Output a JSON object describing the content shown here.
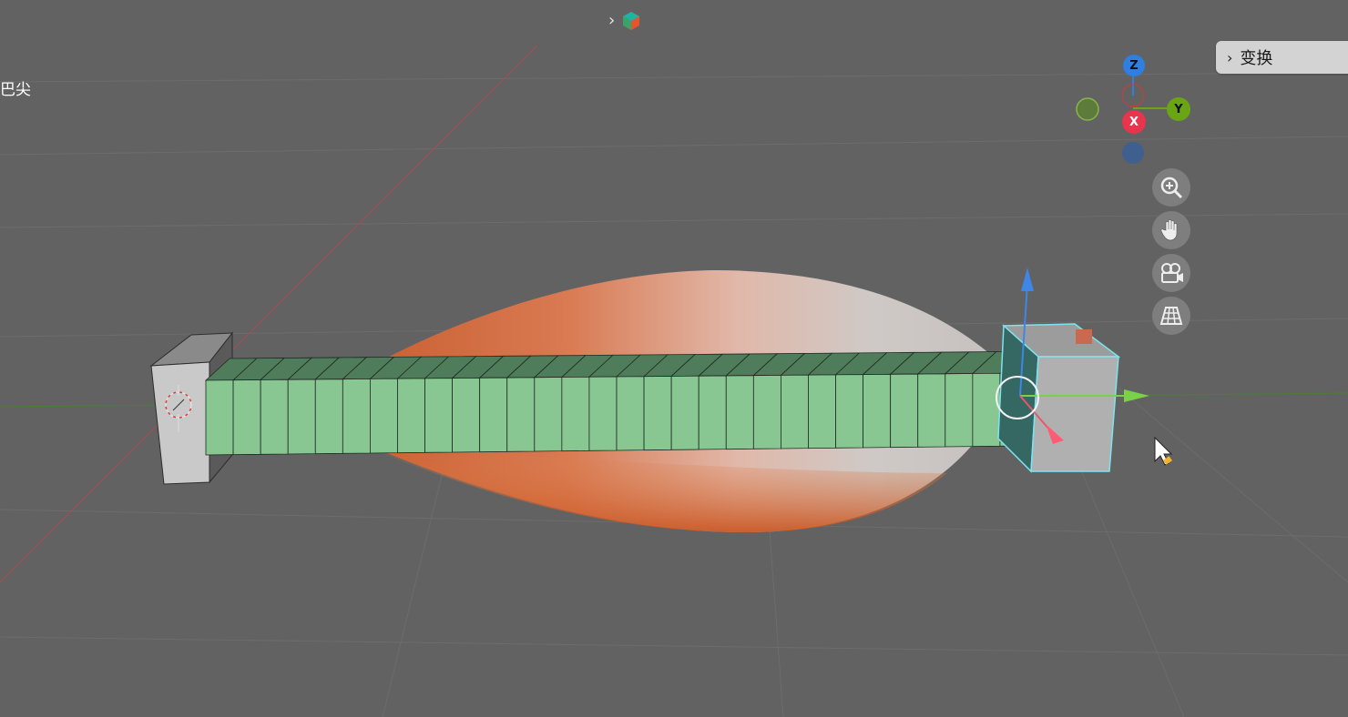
{
  "viewport": {
    "object_label": "巴尖",
    "breadcrumb": {
      "chevron": "›",
      "icon": "object-data-icon"
    }
  },
  "sidebar_panel": {
    "tab_label": "变换",
    "chevron": "›"
  },
  "axis_gizmo": {
    "z_label": "Z",
    "y_label": "Y",
    "x_label": "X",
    "colors": {
      "z": "#2f7fe0",
      "y": "#6aa516",
      "x": "#e8344c"
    }
  },
  "nav_tools": [
    {
      "name": "zoom-icon",
      "label": ""
    },
    {
      "name": "hand-pan-icon",
      "label": ""
    },
    {
      "name": "camera-view-icon",
      "label": ""
    },
    {
      "name": "perspective-grid-icon",
      "label": ""
    }
  ],
  "colors": {
    "background": "#626262",
    "mesh_green": "#88c792",
    "bulge_orange": "#d46a3a",
    "selection_cyan": "#7fe3ef"
  }
}
